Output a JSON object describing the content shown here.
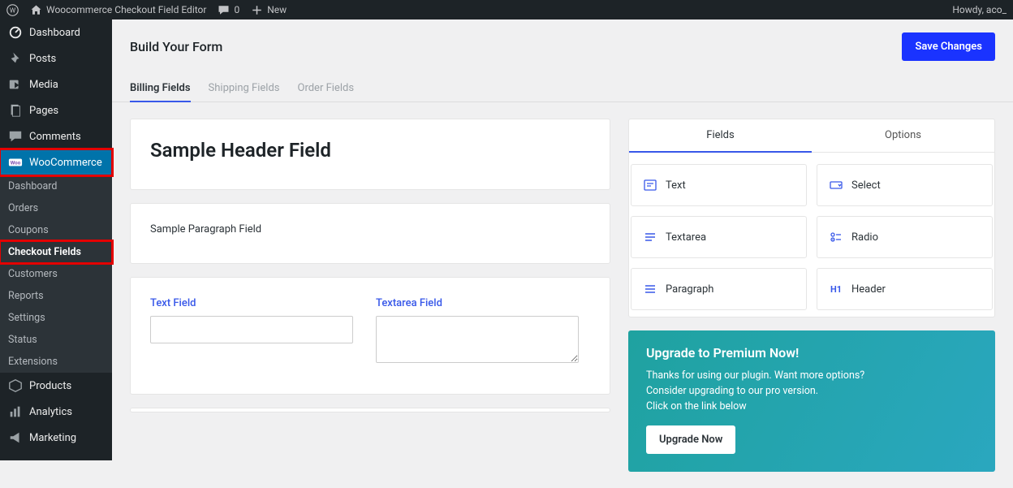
{
  "adminbar": {
    "site_title": "Woocommerce Checkout Field Editor",
    "comments": "0",
    "new_label": "New",
    "howdy": "Howdy, aco_"
  },
  "sidebar": {
    "items": [
      {
        "label": "Dashboard"
      },
      {
        "label": "Posts"
      },
      {
        "label": "Media"
      },
      {
        "label": "Pages"
      },
      {
        "label": "Comments"
      },
      {
        "label": "WooCommerce"
      },
      {
        "label": "Products"
      },
      {
        "label": "Analytics"
      },
      {
        "label": "Marketing"
      }
    ],
    "woo_submenu": [
      {
        "label": "Dashboard"
      },
      {
        "label": "Orders"
      },
      {
        "label": "Coupons"
      },
      {
        "label": "Checkout Fields"
      },
      {
        "label": "Customers"
      },
      {
        "label": "Reports"
      },
      {
        "label": "Settings"
      },
      {
        "label": "Status"
      },
      {
        "label": "Extensions"
      }
    ]
  },
  "page": {
    "title": "Build Your Form",
    "save_btn": "Save Changes"
  },
  "tabs": [
    {
      "label": "Billing Fields"
    },
    {
      "label": "Shipping Fields"
    },
    {
      "label": "Order Fields"
    }
  ],
  "builder": {
    "sample_header": "Sample Header Field",
    "sample_paragraph": "Sample Paragraph Field",
    "text_label": "Text Field",
    "textarea_label": "Textarea Field"
  },
  "panel": {
    "tabs": {
      "fields": "Fields",
      "options": "Options"
    },
    "field_types": {
      "text": "Text",
      "select": "Select",
      "textarea": "Textarea",
      "radio": "Radio",
      "paragraph": "Paragraph",
      "header": "Header"
    }
  },
  "promo": {
    "title": "Upgrade to Premium Now!",
    "line1": "Thanks for using our plugin. Want more options?",
    "line2": "Consider upgrading to our pro version.",
    "line3": "Click on the link below",
    "btn": "Upgrade Now"
  }
}
